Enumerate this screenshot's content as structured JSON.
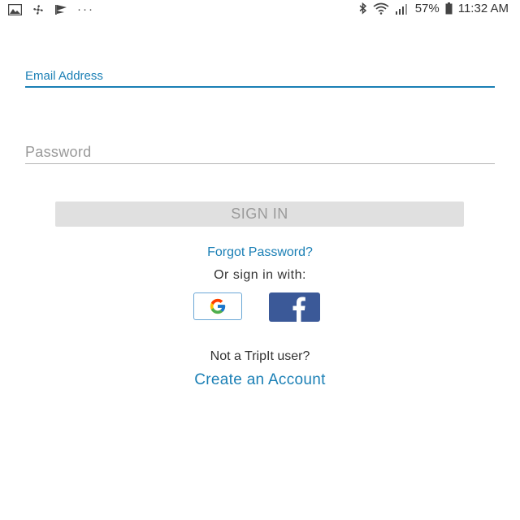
{
  "status_bar": {
    "left_icons": [
      "image-icon",
      "pinwheel-icon",
      "flag-icon"
    ],
    "more": "···",
    "right_icons": [
      "bluetooth-icon",
      "wifi-icon",
      "signal-icon",
      "battery-icon"
    ],
    "battery": "57%",
    "time": "11:32 AM"
  },
  "form": {
    "email_label": "Email Address",
    "password_placeholder": "Password",
    "sign_in_label": "SIGN IN",
    "forgot_password": "Forgot Password?",
    "or_sign_in_with": "Or sign in with:",
    "social": [
      "google-icon",
      "facebook-icon"
    ]
  },
  "footer": {
    "not_user": "Not a TripIt user?",
    "create_account": "Create an Account"
  },
  "colors": {
    "accent": "#1a7fb5",
    "button_bg": "#e0e0e0",
    "button_text": "#9a9a9a",
    "facebook": "#3b5998"
  }
}
